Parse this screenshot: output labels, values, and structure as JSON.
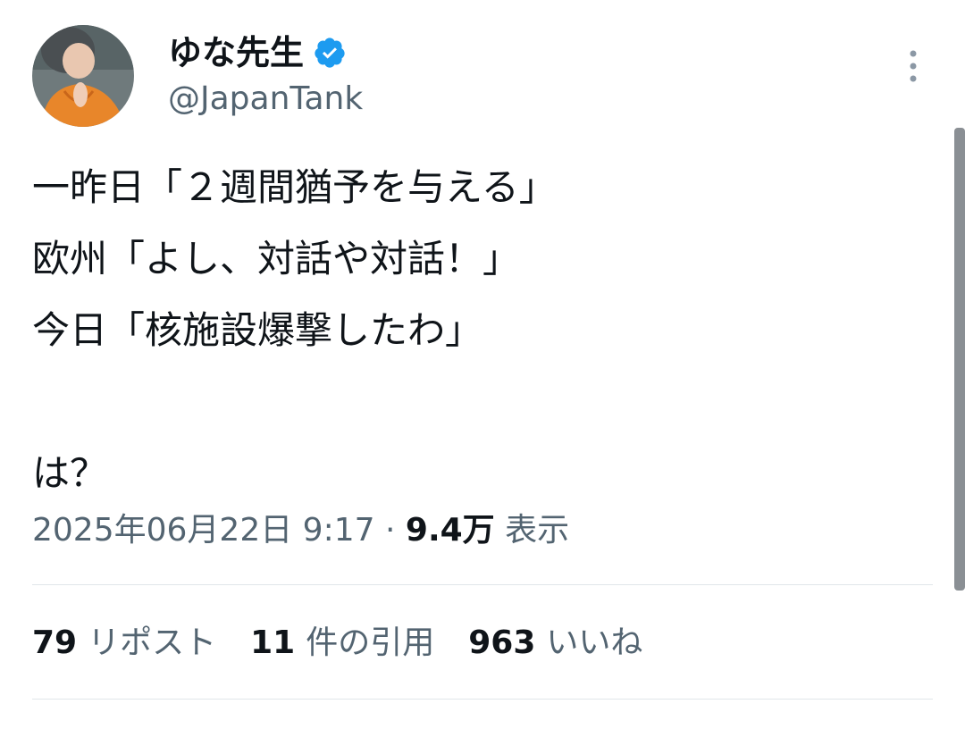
{
  "user": {
    "display_name": "ゆな先生",
    "handle": "@JapanTank",
    "verified_icon": "verified-badge-icon",
    "avatar_icon": "avatar"
  },
  "menu": {
    "more_icon": "more-vertical-icon"
  },
  "tweet": {
    "lines": [
      "一昨日「２週間猶予を与える」",
      "欧州「よし、対話や対話！」",
      "今日「核施設爆撃したわ」",
      "",
      "は？"
    ]
  },
  "meta": {
    "timestamp": "2025年06月22日 9:17",
    "separator": "·",
    "views_count": "9.4万",
    "views_label": "表示"
  },
  "stats": {
    "reposts_count": "79",
    "reposts_label": "リポスト",
    "quotes_count": "11",
    "quotes_label": "件の引用",
    "likes_count": "963",
    "likes_label": "いいね"
  },
  "colors": {
    "text_primary": "#0f1419",
    "text_secondary": "#536471",
    "verified_blue": "#1d9bf0",
    "divider": "#e1e6ea"
  }
}
